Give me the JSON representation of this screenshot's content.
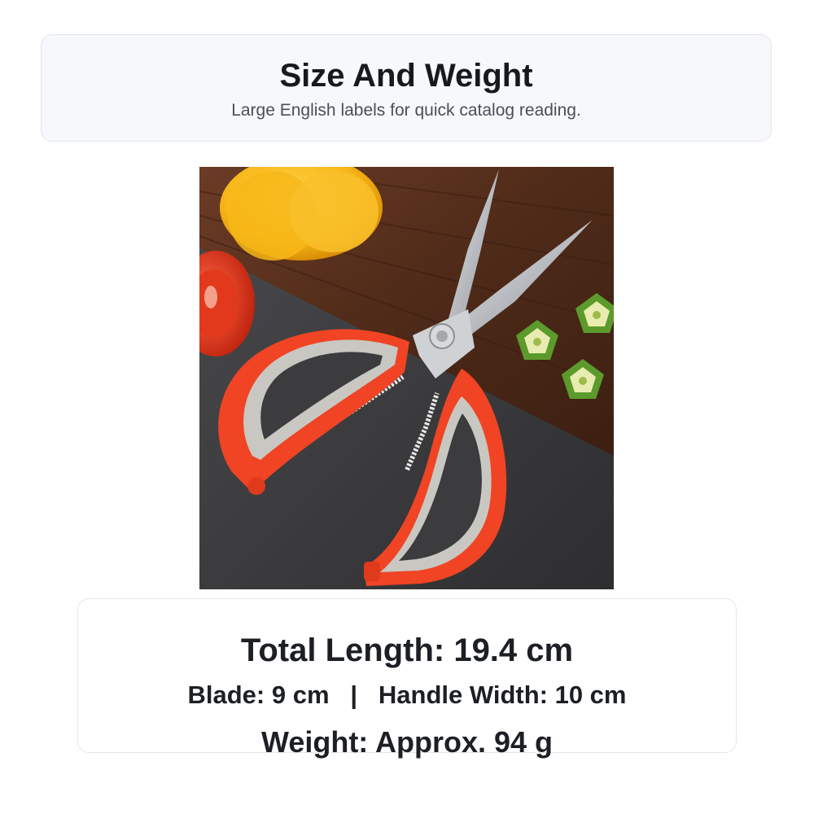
{
  "header": {
    "title": "Size And Weight",
    "subtitle": "Large English labels for quick catalog reading."
  },
  "photo": {
    "subject": "kitchen scissors with red and grey handles on cutting board with yellow pepper, tomato and okra slices"
  },
  "specs": {
    "total_length": "Total Length: 19.4 cm",
    "blade": "Blade: 9 cm",
    "separator": "|",
    "handle_width": "Handle Width: 10 cm",
    "weight": "Weight: Approx. 94 g"
  },
  "colors": {
    "handle_red": "#f04424",
    "handle_grey": "#c9c7c2",
    "board_wood": "#5a3220",
    "pepper_yellow": "#f7b718"
  }
}
